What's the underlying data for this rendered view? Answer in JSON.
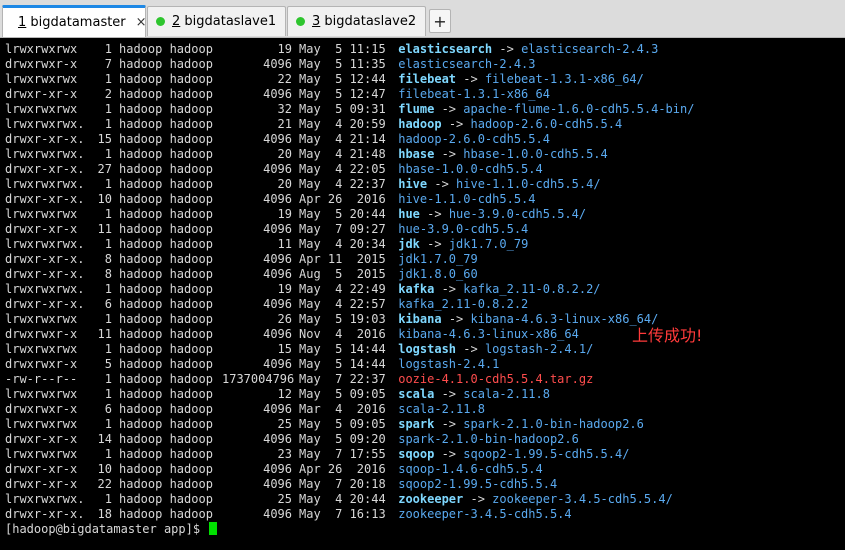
{
  "tabs": [
    {
      "number": "1",
      "name": " bigdatamaster",
      "active": true,
      "close": "×"
    },
    {
      "number": "2",
      "name": " bigdataslave1",
      "active": false
    },
    {
      "number": "3",
      "name": " bigdataslave2",
      "active": false
    }
  ],
  "new_tab_label": "+",
  "listing": [
    {
      "perm": "lrwxrwxrwx",
      "links": "1",
      "owner": "hadoop hadoop",
      "size": "19",
      "date": "May  5 11:15",
      "name": "elasticsearch",
      "kind": "link",
      "target": "elasticsearch-2.4.3"
    },
    {
      "perm": "drwxrwxr-x",
      "links": "7",
      "owner": "hadoop hadoop",
      "size": "4096",
      "date": "May  5 11:35",
      "name": "elasticsearch-2.4.3",
      "kind": "dir"
    },
    {
      "perm": "lrwxrwxrwx",
      "links": "1",
      "owner": "hadoop hadoop",
      "size": "22",
      "date": "May  5 12:44",
      "name": "filebeat",
      "kind": "link",
      "target": "filebeat-1.3.1-x86_64/"
    },
    {
      "perm": "drwxr-xr-x",
      "links": "2",
      "owner": "hadoop hadoop",
      "size": "4096",
      "date": "May  5 12:47",
      "name": "filebeat-1.3.1-x86_64",
      "kind": "dir"
    },
    {
      "perm": "lrwxrwxrwx",
      "links": "1",
      "owner": "hadoop hadoop",
      "size": "32",
      "date": "May  5 09:31",
      "name": "flume",
      "kind": "link",
      "target": "apache-flume-1.6.0-cdh5.5.4-bin/"
    },
    {
      "perm": "lrwxrwxrwx.",
      "links": "1",
      "owner": "hadoop hadoop",
      "size": "21",
      "date": "May  4 20:59",
      "name": "hadoop",
      "kind": "link",
      "target": "hadoop-2.6.0-cdh5.5.4"
    },
    {
      "perm": "drwxr-xr-x.",
      "links": "15",
      "owner": "hadoop hadoop",
      "size": "4096",
      "date": "May  4 21:14",
      "name": "hadoop-2.6.0-cdh5.5.4",
      "kind": "dir"
    },
    {
      "perm": "lrwxrwxrwx.",
      "links": "1",
      "owner": "hadoop hadoop",
      "size": "20",
      "date": "May  4 21:48",
      "name": "hbase",
      "kind": "link",
      "target": "hbase-1.0.0-cdh5.5.4"
    },
    {
      "perm": "drwxr-xr-x.",
      "links": "27",
      "owner": "hadoop hadoop",
      "size": "4096",
      "date": "May  4 22:05",
      "name": "hbase-1.0.0-cdh5.5.4",
      "kind": "dir"
    },
    {
      "perm": "lrwxrwxrwx.",
      "links": "1",
      "owner": "hadoop hadoop",
      "size": "20",
      "date": "May  4 22:37",
      "name": "hive",
      "kind": "link",
      "target": "hive-1.1.0-cdh5.5.4/"
    },
    {
      "perm": "drwxr-xr-x.",
      "links": "10",
      "owner": "hadoop hadoop",
      "size": "4096",
      "date": "Apr 26  2016",
      "name": "hive-1.1.0-cdh5.5.4",
      "kind": "dir"
    },
    {
      "perm": "lrwxrwxrwx",
      "links": "1",
      "owner": "hadoop hadoop",
      "size": "19",
      "date": "May  5 20:44",
      "name": "hue",
      "kind": "link",
      "target": "hue-3.9.0-cdh5.5.4/"
    },
    {
      "perm": "drwxr-xr-x",
      "links": "11",
      "owner": "hadoop hadoop",
      "size": "4096",
      "date": "May  7 09:27",
      "name": "hue-3.9.0-cdh5.5.4",
      "kind": "dir"
    },
    {
      "perm": "lrwxrwxrwx.",
      "links": "1",
      "owner": "hadoop hadoop",
      "size": "11",
      "date": "May  4 20:34",
      "name": "jdk",
      "kind": "link",
      "target": "jdk1.7.0_79"
    },
    {
      "perm": "drwxr-xr-x.",
      "links": "8",
      "owner": "hadoop hadoop",
      "size": "4096",
      "date": "Apr 11  2015",
      "name": "jdk1.7.0_79",
      "kind": "dir"
    },
    {
      "perm": "drwxr-xr-x.",
      "links": "8",
      "owner": "hadoop hadoop",
      "size": "4096",
      "date": "Aug  5  2015",
      "name": "jdk1.8.0_60",
      "kind": "dir"
    },
    {
      "perm": "lrwxrwxrwx.",
      "links": "1",
      "owner": "hadoop hadoop",
      "size": "19",
      "date": "May  4 22:49",
      "name": "kafka",
      "kind": "link",
      "target": "kafka_2.11-0.8.2.2/"
    },
    {
      "perm": "drwxr-xr-x.",
      "links": "6",
      "owner": "hadoop hadoop",
      "size": "4096",
      "date": "May  4 22:57",
      "name": "kafka_2.11-0.8.2.2",
      "kind": "dir"
    },
    {
      "perm": "lrwxrwxrwx",
      "links": "1",
      "owner": "hadoop hadoop",
      "size": "26",
      "date": "May  5 19:03",
      "name": "kibana",
      "kind": "link",
      "target": "kibana-4.6.3-linux-x86_64/"
    },
    {
      "perm": "drwxrwxr-x",
      "links": "11",
      "owner": "hadoop hadoop",
      "size": "4096",
      "date": "Nov  4  2016",
      "name": "kibana-4.6.3-linux-x86_64",
      "kind": "dir"
    },
    {
      "perm": "lrwxrwxrwx",
      "links": "1",
      "owner": "hadoop hadoop",
      "size": "15",
      "date": "May  5 14:44",
      "name": "logstash",
      "kind": "link",
      "target": "logstash-2.4.1/"
    },
    {
      "perm": "drwxrwxr-x",
      "links": "5",
      "owner": "hadoop hadoop",
      "size": "4096",
      "date": "May  5 14:44",
      "name": "logstash-2.4.1",
      "kind": "dir"
    },
    {
      "perm": "-rw-r--r--",
      "links": "1",
      "owner": "hadoop hadoop",
      "size": "1737004796",
      "date": "May  7 22:37",
      "name": "oozie-4.1.0-cdh5.5.4.tar.gz",
      "kind": "archive"
    },
    {
      "perm": "lrwxrwxrwx",
      "links": "1",
      "owner": "hadoop hadoop",
      "size": "12",
      "date": "May  5 09:05",
      "name": "scala",
      "kind": "link",
      "target": "scala-2.11.8"
    },
    {
      "perm": "drwxrwxr-x",
      "links": "6",
      "owner": "hadoop hadoop",
      "size": "4096",
      "date": "Mar  4  2016",
      "name": "scala-2.11.8",
      "kind": "dir"
    },
    {
      "perm": "lrwxrwxrwx",
      "links": "1",
      "owner": "hadoop hadoop",
      "size": "25",
      "date": "May  5 09:05",
      "name": "spark",
      "kind": "link",
      "target": "spark-2.1.0-bin-hadoop2.6"
    },
    {
      "perm": "drwxr-xr-x",
      "links": "14",
      "owner": "hadoop hadoop",
      "size": "4096",
      "date": "May  5 09:20",
      "name": "spark-2.1.0-bin-hadoop2.6",
      "kind": "dir"
    },
    {
      "perm": "lrwxrwxrwx",
      "links": "1",
      "owner": "hadoop hadoop",
      "size": "23",
      "date": "May  7 17:55",
      "name": "sqoop",
      "kind": "link",
      "target": "sqoop2-1.99.5-cdh5.5.4/"
    },
    {
      "perm": "drwxr-xr-x",
      "links": "10",
      "owner": "hadoop hadoop",
      "size": "4096",
      "date": "Apr 26  2016",
      "name": "sqoop-1.4.6-cdh5.5.4",
      "kind": "dir"
    },
    {
      "perm": "drwxr-xr-x",
      "links": "22",
      "owner": "hadoop hadoop",
      "size": "4096",
      "date": "May  7 20:18",
      "name": "sqoop2-1.99.5-cdh5.5.4",
      "kind": "dir"
    },
    {
      "perm": "lrwxrwxrwx.",
      "links": "1",
      "owner": "hadoop hadoop",
      "size": "25",
      "date": "May  4 20:44",
      "name": "zookeeper",
      "kind": "link",
      "target": "zookeeper-3.4.5-cdh5.5.4/"
    },
    {
      "perm": "drwxr-xr-x.",
      "links": "18",
      "owner": "hadoop hadoop",
      "size": "4096",
      "date": "May  7 16:13",
      "name": "zookeeper-3.4.5-cdh5.5.4",
      "kind": "dir"
    }
  ],
  "link_arrow": " -> ",
  "prompt": "[hadoop@bigdatamaster app]$ ",
  "annotation": "上传成功!",
  "colors": {
    "background": "#000000",
    "text": "#d8d8d8",
    "symlink_name": "#7fd8ff",
    "directory": "#5aaaf0",
    "archive": "#ff4d4d",
    "annotation": "#ff3a3a",
    "cursor": "#00e000",
    "active_tab_accent": "#1e88e5",
    "session_dot": "#2ec52e"
  }
}
